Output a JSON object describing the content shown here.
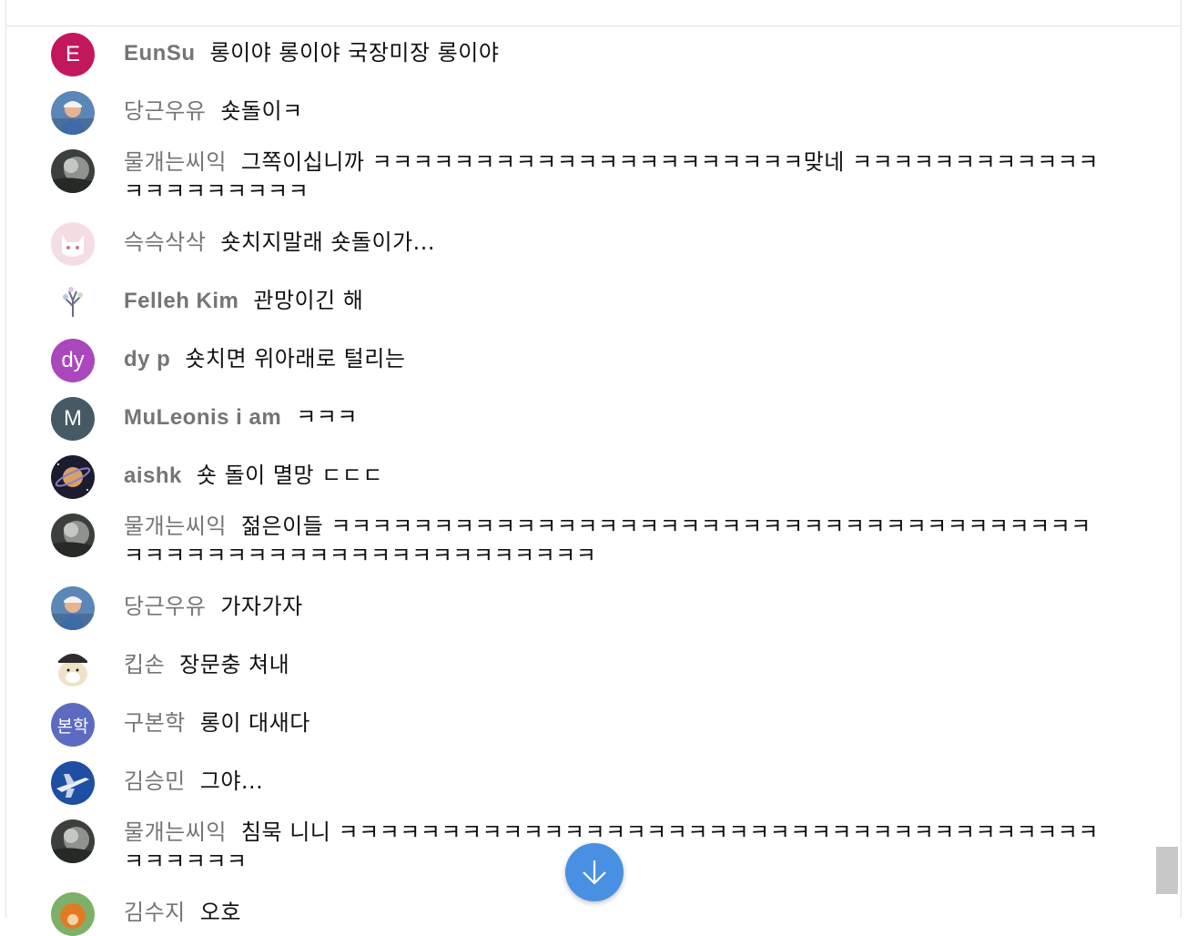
{
  "messages": [
    {
      "author": "EunSu",
      "text": "롱이야 롱이야 국장미장 롱이야",
      "avatar": {
        "type": "letter",
        "letter": "E",
        "color": "#c2185b"
      }
    },
    {
      "author": "당근우유",
      "text": "숏돌이ㅋ",
      "avatar": {
        "type": "photo",
        "icon": "person-photo-icon"
      }
    },
    {
      "author": "물개는씨익",
      "text": "그쪽이십니까 ㅋㅋㅋㅋㅋㅋㅋㅋㅋㅋㅋㅋㅋㅋㅋㅋㅋㅋㅋㅋㅋ맞네 ㅋㅋㅋㅋㅋㅋㅋㅋㅋㅋㅋㅋㅋㅋㅋㅋㅋㅋㅋㅋㅋ",
      "avatar": {
        "type": "photo",
        "icon": "dark-photo-icon"
      }
    },
    {
      "author": "슥슥삭삭",
      "text": "숏치지말래 숏돌이가...",
      "avatar": {
        "type": "photo",
        "icon": "pink-cat-icon"
      }
    },
    {
      "author": "Felleh Kim",
      "text": "관망이긴 해",
      "avatar": {
        "type": "photo",
        "icon": "tree-drawing-icon"
      }
    },
    {
      "author": "dy p",
      "text": "숏치면 위아래로 털리는",
      "avatar": {
        "type": "letter",
        "letter": "dy",
        "color": "#ab47bc"
      }
    },
    {
      "author": "MuLeonis i am",
      "text": "ㅋㅋㅋ",
      "avatar": {
        "type": "letter",
        "letter": "M",
        "color": "#455a64"
      }
    },
    {
      "author": "aishk",
      "text": "숏 돌이 멸망 ㄷㄷㄷ",
      "avatar": {
        "type": "photo",
        "icon": "planet-icon"
      }
    },
    {
      "author": "물개는씨익",
      "text": "젊은이들 ㅋㅋㅋㅋㅋㅋㅋㅋㅋㅋㅋㅋㅋㅋㅋㅋㅋㅋㅋㅋㅋㅋㅋㅋㅋㅋㅋㅋㅋㅋㅋㅋㅋㅋㅋㅋㅋㅋㅋㅋㅋㅋㅋㅋㅋㅋㅋㅋㅋㅋㅋㅋㅋㅋㅋㅋㅋㅋㅋㅋ",
      "avatar": {
        "type": "photo",
        "icon": "dark-photo-icon"
      }
    },
    {
      "author": "당근우유",
      "text": "가자가자",
      "avatar": {
        "type": "photo",
        "icon": "person-photo-icon"
      }
    },
    {
      "author": "킵손",
      "text": "장문충 쳐내",
      "avatar": {
        "type": "photo",
        "icon": "dog-with-cap-icon"
      }
    },
    {
      "author": "구본학",
      "text": "롱이 대새다",
      "avatar": {
        "type": "letter",
        "letter": "본학",
        "color": "#5c6bc0"
      }
    },
    {
      "author": "김승민",
      "text": "그야...",
      "avatar": {
        "type": "photo",
        "icon": "jet-plane-icon"
      }
    },
    {
      "author": "물개는씨익",
      "text": "침묵 니니 ㅋㅋㅋㅋㅋㅋㅋㅋㅋㅋㅋㅋㅋㅋㅋㅋㅋㅋㅋㅋㅋㅋㅋㅋㅋㅋㅋㅋㅋㅋㅋㅋㅋㅋㅋㅋㅋㅋㅋㅋㅋㅋㅋ",
      "avatar": {
        "type": "photo",
        "icon": "dark-photo-icon"
      }
    },
    {
      "author": "김수지",
      "text": "오호",
      "avatar": {
        "type": "photo",
        "icon": "orange-animal-icon"
      }
    }
  ],
  "scroll_down_button": {
    "icon": "arrow-down-icon",
    "color": "#4a90e2"
  }
}
